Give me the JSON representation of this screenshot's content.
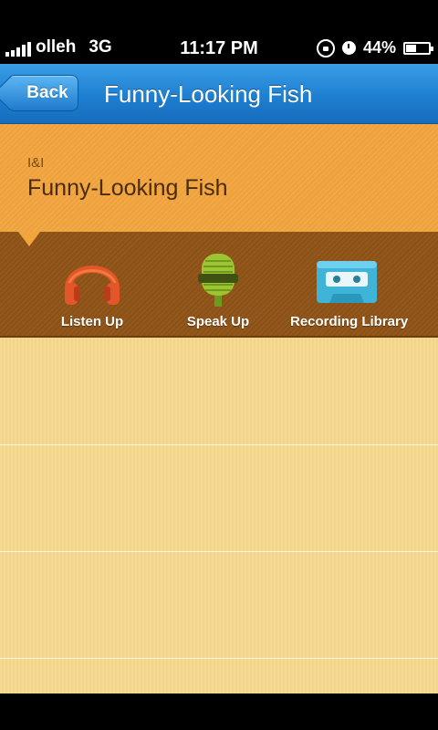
{
  "status_bar": {
    "carrier": "olleh",
    "network": "3G",
    "time": "11:17 PM",
    "battery_percent": "44%",
    "battery_level": 0.44,
    "signal_bars": 5,
    "icons": [
      "signal-icon",
      "rotation-lock-icon",
      "alarm-icon",
      "battery-icon"
    ]
  },
  "nav": {
    "back_label": "Back",
    "title": "Funny-Looking Fish"
  },
  "header": {
    "subtitle": "I&I",
    "title": "Funny-Looking Fish"
  },
  "toolbar": {
    "items": [
      {
        "label": "Listen Up",
        "icon": "headphones-icon"
      },
      {
        "label": "Speak Up",
        "icon": "microphone-icon"
      },
      {
        "label": "Recording Library",
        "icon": "cassette-icon"
      }
    ]
  },
  "colors": {
    "nav_blue": "#1e7fd1",
    "header_orange": "#f2a43d",
    "toolbar_brown": "#8e5316",
    "paper": "#f6d88e"
  }
}
